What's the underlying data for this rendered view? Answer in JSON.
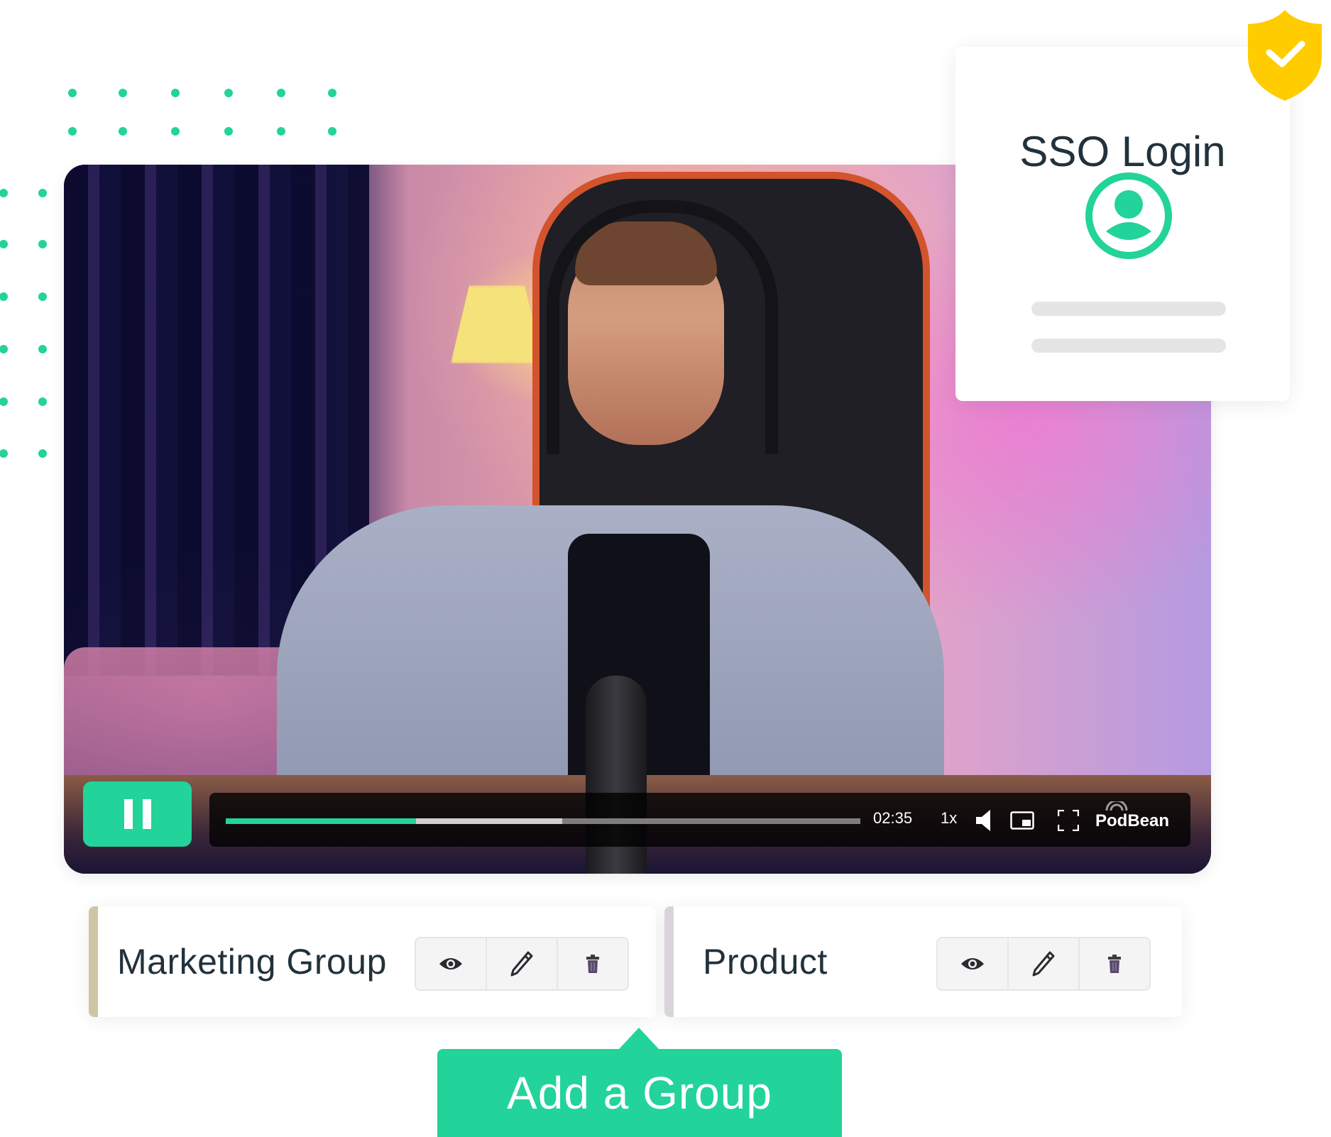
{
  "colors": {
    "accent": "#22d39a",
    "shield": "#ffcc00",
    "text_dark": "#22323c",
    "group_accent_marketing": "#cdc6a6",
    "group_accent_product": "#d9d4dc"
  },
  "video_player": {
    "play_state": "playing",
    "pause_button_icon": "pause-icon",
    "progress": {
      "played_fraction": 0.3,
      "buffered_fraction": 0.53
    },
    "time": "02:35",
    "speed": "1x",
    "icons": [
      "volume-icon",
      "picture-in-picture-icon",
      "fullscreen-icon"
    ],
    "brand": "PodBean"
  },
  "sso_card": {
    "title": "SSO Login",
    "avatar_icon": "user-circle-icon",
    "badge_icon": "shield-check-icon"
  },
  "groups": [
    {
      "name": "Marketing Group",
      "actions": [
        "view",
        "edit",
        "delete"
      ]
    },
    {
      "name": "Product",
      "actions": [
        "view",
        "edit",
        "delete"
      ]
    }
  ],
  "add_group_button": {
    "label": "Add a Group"
  }
}
